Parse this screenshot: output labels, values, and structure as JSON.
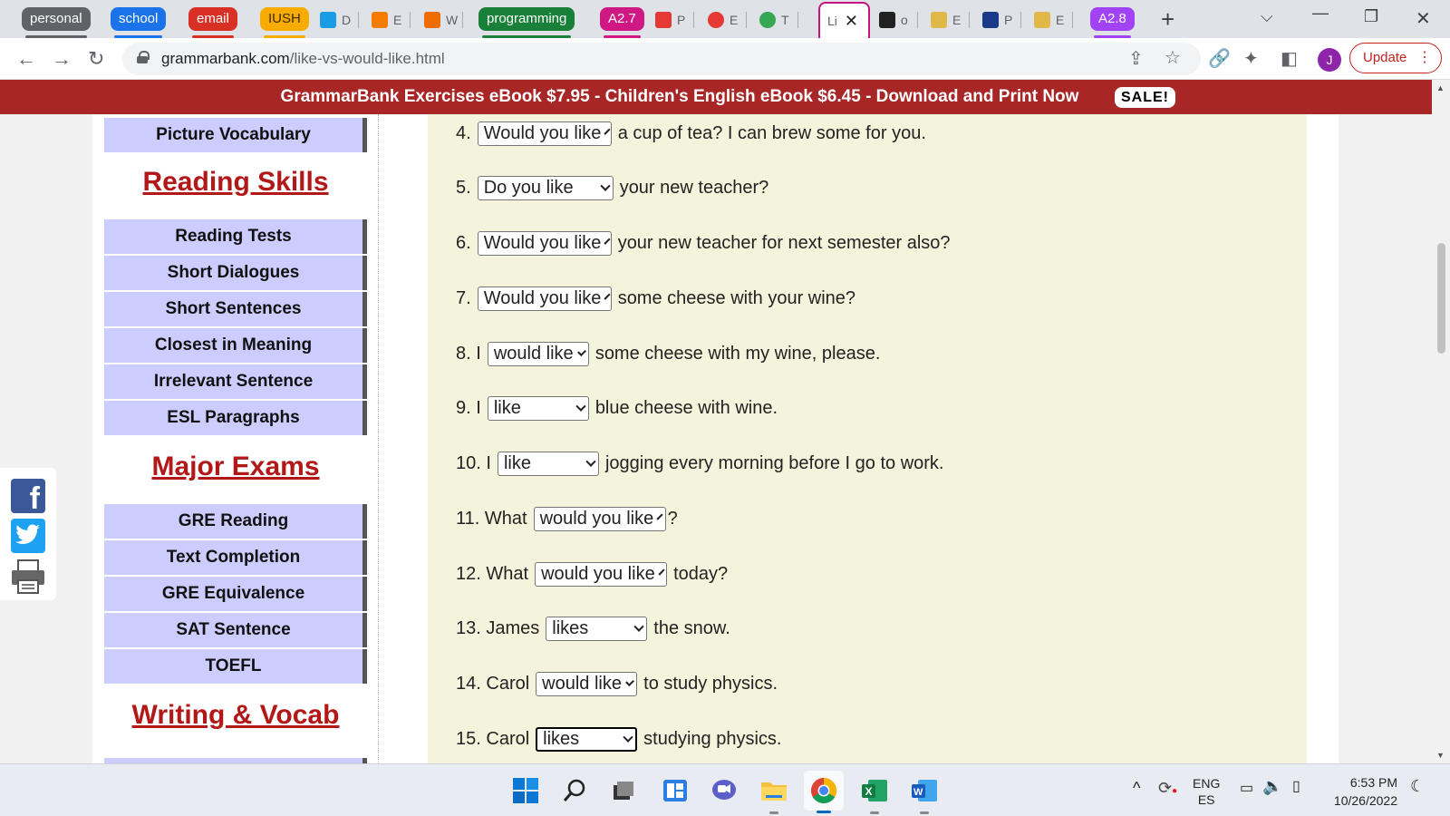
{
  "tabs": {
    "groups": [
      {
        "label": "personal",
        "color": "#5f6368"
      },
      {
        "label": "school",
        "color": "#1a73e8"
      },
      {
        "label": "email",
        "color": "#d93025"
      },
      {
        "label": "IUSH",
        "color": "#f9ab00"
      },
      {
        "label": "programming",
        "color": "#188038"
      },
      {
        "label": "A2.7",
        "color": "#d01884"
      },
      {
        "label": "A2.8",
        "color": "#a142f4"
      }
    ],
    "mini": [
      {
        "letter": "D",
        "color": "#1a9be6"
      },
      {
        "letter": "E",
        "color": "#f57c00"
      },
      {
        "letter": "W",
        "color": "#ef6c00"
      },
      {
        "letter": "P",
        "color": "#e53935"
      },
      {
        "letter": "E",
        "color": "#e53935"
      },
      {
        "letter": "T",
        "color": "#34a853"
      },
      {
        "letter": "o",
        "color": "#222222"
      },
      {
        "letter": "E",
        "color": "#e0b84a"
      },
      {
        "letter": "P",
        "color": "#1a3a8a"
      },
      {
        "letter": "E",
        "color": "#e0b84a"
      }
    ],
    "active": {
      "letter": "Li"
    }
  },
  "toolbar": {
    "url_host": "grammarbank.com",
    "url_path": "/like-vs-would-like.html",
    "avatar": "J",
    "update_label": "Update"
  },
  "banner": {
    "text": "GrammarBank Exercises eBook $7.95 - Children's English eBook $6.45 - Download and Print Now",
    "sale": "SALE!"
  },
  "sidebar": {
    "top_item": "Picture Vocabulary",
    "reading_heading": "Reading Skills",
    "reading_items": [
      "Reading Tests",
      "Short Dialogues",
      "Short Sentences",
      "Closest in Meaning",
      "Irrelevant Sentence",
      "ESL Paragraphs"
    ],
    "exams_heading": "Major Exams",
    "exams_items": [
      "GRE Reading",
      "Text Completion",
      "GRE Equivalence",
      "SAT Sentence",
      "TOEFL"
    ],
    "writing_heading": "Writing & Vocab"
  },
  "questions": [
    {
      "num": "4.",
      "pre": "",
      "answer": "Would you like",
      "post": "a cup of tea? I can brew some for you."
    },
    {
      "num": "5.",
      "pre": "",
      "answer": "Do you like",
      "post": "your new teacher?"
    },
    {
      "num": "6.",
      "pre": "",
      "answer": "Would you like",
      "post": "your new teacher for next semester also?"
    },
    {
      "num": "7.",
      "pre": "",
      "answer": "Would you like",
      "post": "some cheese with your wine?"
    },
    {
      "num": "8.",
      "pre": "I",
      "answer": "would like",
      "post": "some cheese with my wine, please."
    },
    {
      "num": "9.",
      "pre": "I",
      "answer": "like",
      "post": "blue cheese with wine."
    },
    {
      "num": "10.",
      "pre": "I",
      "answer": "like",
      "post": "jogging every morning before I go to work."
    },
    {
      "num": "11.",
      "pre": "What",
      "answer": "would you like",
      "post": "?"
    },
    {
      "num": "12.",
      "pre": "What",
      "answer": "would you like",
      "post": "today?"
    },
    {
      "num": "13.",
      "pre": "James",
      "answer": "likes",
      "post": "the snow."
    },
    {
      "num": "14.",
      "pre": "Carol",
      "answer": "would like",
      "post": "to study physics."
    },
    {
      "num": "15.",
      "pre": "Carol",
      "answer": "likes",
      "post": "studying physics."
    }
  ],
  "taskbar": {
    "lang_top": "ENG",
    "lang_bottom": "ES",
    "time": "6:53 PM",
    "date": "10/26/2022"
  }
}
